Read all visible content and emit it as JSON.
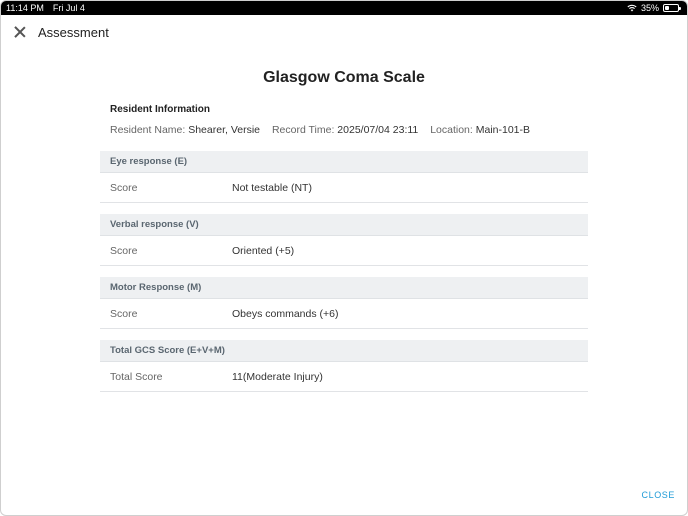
{
  "status_bar": {
    "time": "11:14 PM",
    "date": "Fri Jul 4",
    "battery": "35%",
    "battery_level": 0.35
  },
  "header": {
    "title": "Assessment",
    "close_icon": "close-icon"
  },
  "form": {
    "title": "Glasgow Coma Scale",
    "resident_heading": "Resident Information",
    "resident_name_label": "Resident Name:",
    "resident_name": "Shearer, Versie",
    "record_time_label": "Record Time:",
    "record_time": "2025/07/04 23:11",
    "location_label": "Location:",
    "location": "Main-101-B"
  },
  "sections": [
    {
      "title": "Eye response (E)",
      "label": "Score",
      "value": "Not testable (NT)"
    },
    {
      "title": "Verbal response (V)",
      "label": "Score",
      "value": "Oriented (+5)"
    },
    {
      "title": "Motor Response (M)",
      "label": "Score",
      "value": "Obeys commands (+6)"
    },
    {
      "title": "Total GCS Score (E+V+M)",
      "label": "Total Score",
      "value": "11(Moderate Injury)"
    }
  ],
  "footer": {
    "close_label": "CLOSE",
    "accent_color": "#1f9bd7"
  }
}
